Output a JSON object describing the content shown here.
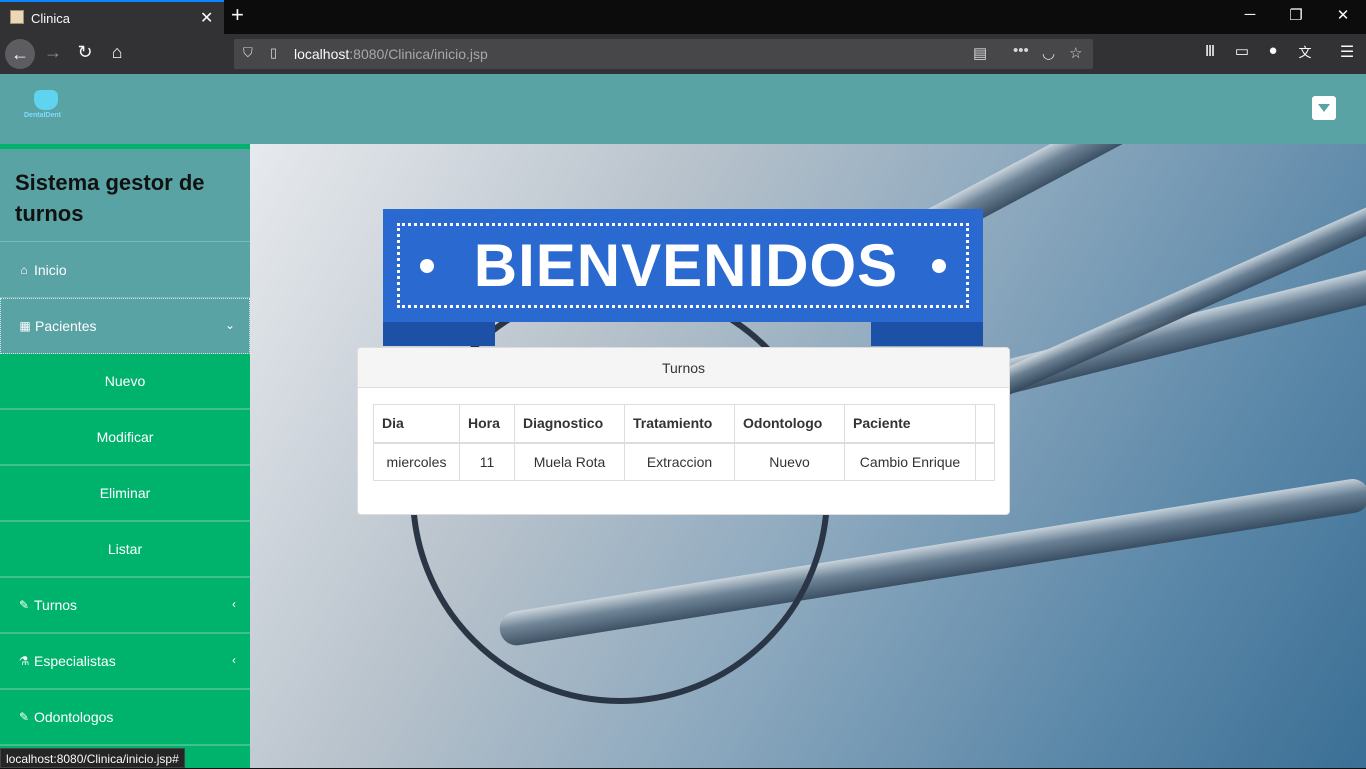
{
  "browser": {
    "tab_title": "Clinica",
    "url_host": "localhost",
    "url_rest": ":8080/Clinica/inicio.jsp",
    "status_url": "localhost:8080/Clinica/inicio.jsp#"
  },
  "app": {
    "logo_text": "DentalDent",
    "sidebar": {
      "title": "Sistema gestor de turnos",
      "items": [
        {
          "label": "Inicio",
          "icon": "home-icon"
        },
        {
          "label": "Pacientes",
          "icon": "chart-icon"
        },
        {
          "label": "Nuevo"
        },
        {
          "label": "Modificar"
        },
        {
          "label": "Eliminar"
        },
        {
          "label": "Listar"
        },
        {
          "label": "Turnos",
          "icon": "edit-icon"
        },
        {
          "label": "Especialistas",
          "icon": "flask-icon"
        },
        {
          "label": "Odontologos",
          "icon": "edit-icon"
        }
      ]
    },
    "banner": "BIENVENIDOS",
    "panel": {
      "title": "Turnos",
      "columns": [
        "Dia",
        "Hora",
        "Diagnostico",
        "Tratamiento",
        "Odontologo",
        "Paciente"
      ],
      "rows": [
        [
          "miercoles",
          "11",
          "Muela Rota",
          "Extraccion",
          "Nuevo",
          "Cambio Enrique"
        ]
      ]
    }
  },
  "colors": {
    "header": "#59a3a4",
    "sidebar": "#00b36d",
    "banner": "#2a69cf"
  }
}
